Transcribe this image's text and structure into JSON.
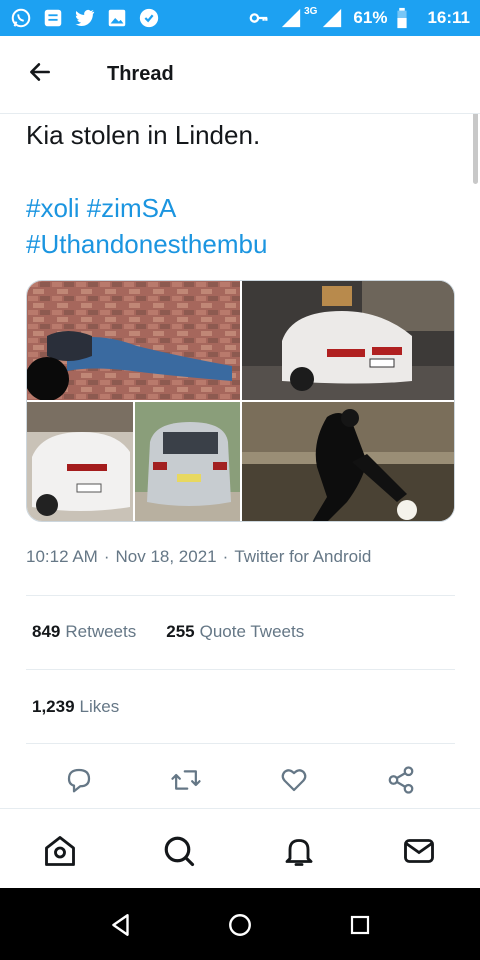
{
  "status_bar": {
    "battery": "61%",
    "time": "16:11",
    "network": "3G",
    "icons": [
      "whatsapp-icon",
      "message-icon",
      "twitter-icon",
      "gallery-icon",
      "notification-app-icon",
      "key-icon",
      "signal-icon",
      "battery-icon"
    ]
  },
  "header": {
    "title": "Thread"
  },
  "tweet": {
    "text": "Kia stolen in Linden.",
    "hashtags": [
      "#xoli",
      "#zimSA",
      "#Uthandonesthembu"
    ],
    "timestamp": "10:12 AM",
    "date": "Nov 18, 2021",
    "source": "Twitter for Android",
    "retweets_count": "849",
    "retweets_label": "Retweets",
    "quotes_count": "255",
    "quotes_label": "Quote Tweets",
    "likes_count": "1,239",
    "likes_label": "Likes"
  },
  "colors": {
    "accent": "#1da1f2",
    "link": "#1b95e0",
    "muted": "#657786"
  }
}
